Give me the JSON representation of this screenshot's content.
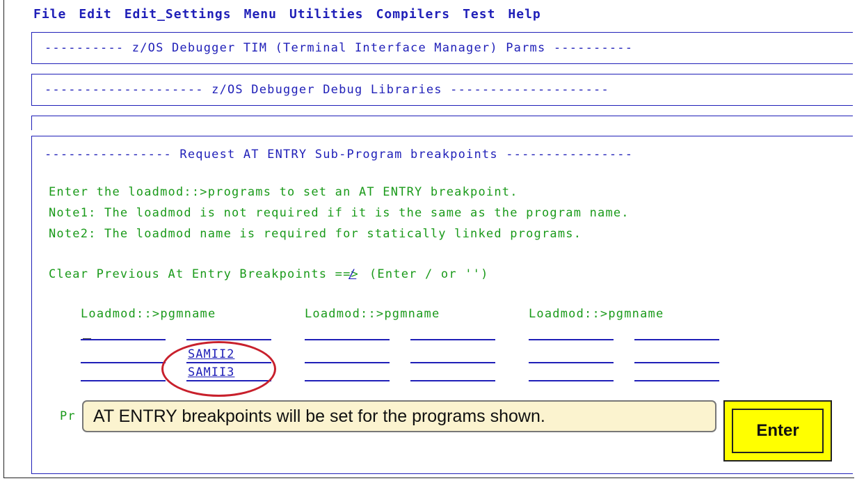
{
  "menu": [
    "File",
    "Edit",
    "Edit_Settings",
    "Menu",
    "Utilities",
    "Compilers",
    "Test",
    "Help"
  ],
  "panels": {
    "tim": "---------- z/OS Debugger TIM (Terminal Interface Manager) Parms ----------",
    "libs": "-------------------- z/OS Debugger Debug Libraries --------------------",
    "request": "---------------- Request AT ENTRY Sub-Program breakpoints ----------------"
  },
  "instructions": {
    "line1": "Enter the loadmod::>programs to set an AT ENTRY breakpoint.",
    "line2": "Note1: The loadmod is not required if it is the same as the program name.",
    "line3": "Note2: The loadmod name is required for statically linked programs."
  },
  "clear": {
    "label": "Clear Previous At Entry Breakpoints ==>",
    "value": "/",
    "hint": "(Enter / or '')"
  },
  "columns": [
    "Loadmod::>pgmname",
    "Loadmod::>pgmname",
    "Loadmod::>pgmname"
  ],
  "programs": [
    "SAMII2",
    "SAMII3"
  ],
  "partial_text": "Pr",
  "tooltip": "AT ENTRY breakpoints will be set for the programs shown.",
  "enter_button": "Enter",
  "colors": {
    "text_blue": "#1f1fb8",
    "text_green": "#1a9a1a",
    "highlight_red": "#c8202c",
    "button_yellow": "#ffff00",
    "tooltip_bg": "#fbf3cf"
  }
}
